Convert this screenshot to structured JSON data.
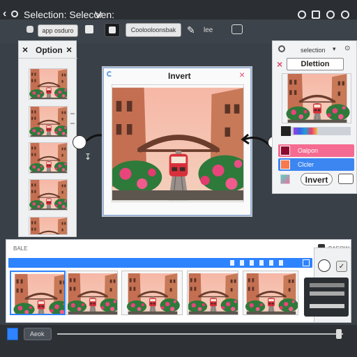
{
  "window": {
    "title": "Selection: Selecor",
    "menu_extra": "Ven:"
  },
  "toolbar": {
    "search_label": "app osduro",
    "mode_label": "Coolooloonsbak",
    "text_tool_label": "lee"
  },
  "left_panel": {
    "title": "Option"
  },
  "dialog": {
    "title": "Invert"
  },
  "right_panel": {
    "header_label": "selection",
    "selected_value": "Dlettion",
    "options": [
      {
        "label": "Oalpon",
        "color": "#f56b91"
      },
      {
        "label": "Clcler",
        "color": "#3c86f2"
      }
    ],
    "invert_button": "Invert"
  },
  "strip": {
    "left_label": "BALE",
    "right_label": "BAEOW"
  },
  "statusbar": {
    "back_label": "Aeok"
  },
  "colors": {
    "accent_blue": "#2e83ff",
    "pink": "#f56b91",
    "dark": "#2b2f34"
  }
}
